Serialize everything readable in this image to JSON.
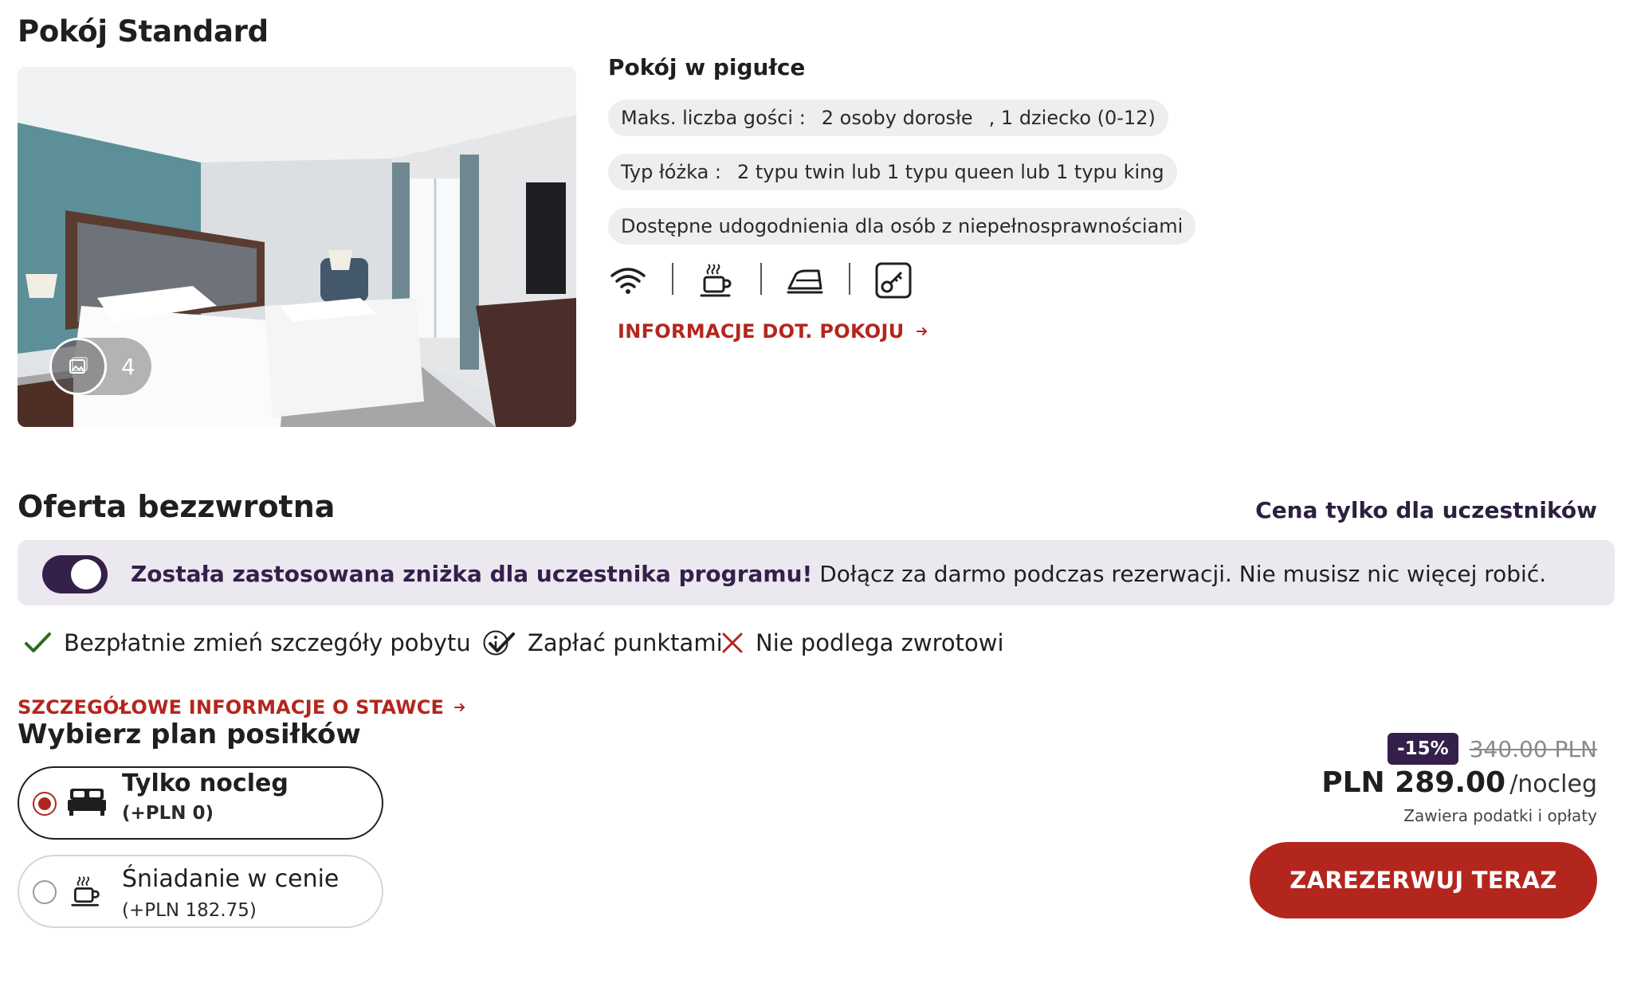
{
  "room": {
    "title": "Pokój Standard",
    "gallery_count": "4"
  },
  "summary": {
    "heading": "Pokój w pigułce",
    "guests": {
      "label": "Maks. liczba gości :",
      "value": "2 osoby dorosłe",
      "value2": ", 1 dziecko (0-12)"
    },
    "bed": {
      "label": "Typ łóżka :",
      "value": "2 typu twin lub 1 typu queen lub 1 typu king"
    },
    "accessibility": "Dostępne udogodnienia dla osób z niepełnosprawnościami",
    "amenities": [
      "wifi-icon",
      "coffee-icon",
      "iron-icon",
      "digital-key-icon"
    ],
    "room_info_link": "INFORMACJE DOT. POKOJU"
  },
  "offer": {
    "title": "Oferta bezzwrotna",
    "member_price_label": "Cena tylko dla uczestników",
    "banner": {
      "bold": "Została zastosowana zniżka dla uczestnika programu!",
      "text": " Dołącz za darmo podczas rezerwacji. Nie musisz nic więcej robić.",
      "toggle_on": true
    },
    "features": [
      {
        "text": "Bezpłatnie zmień szczegóły pobytu",
        "type": "check"
      },
      {
        "text": "Zapłać punktami",
        "type": "check"
      },
      {
        "text": "Nie podlega zwrotowi",
        "type": "cross"
      }
    ],
    "rate_details_link": "SZCZEGÓŁOWE INFORMACJE O STAWCE"
  },
  "meals": {
    "heading": "Wybierz plan posiłków",
    "options": [
      {
        "name": "Tylko nocleg",
        "price": "(+PLN 0)",
        "selected": true
      },
      {
        "name": "Śniadanie w cenie",
        "price": "(+PLN 182.75)",
        "selected": false
      }
    ]
  },
  "price": {
    "discount": "-15%",
    "old": "340.00 PLN",
    "current": "PLN 289.00",
    "per": "/nocleg",
    "taxes": "Zawiera podatki i opłaty",
    "book_button": "ZAREZERWUJ TERAZ"
  },
  "colors": {
    "accent_red": "#b3261e",
    "member_purple": "#34204a",
    "chip_bg": "#eeeeee",
    "banner_bg": "#ebe8ef",
    "check_green": "#2e6b1f"
  }
}
